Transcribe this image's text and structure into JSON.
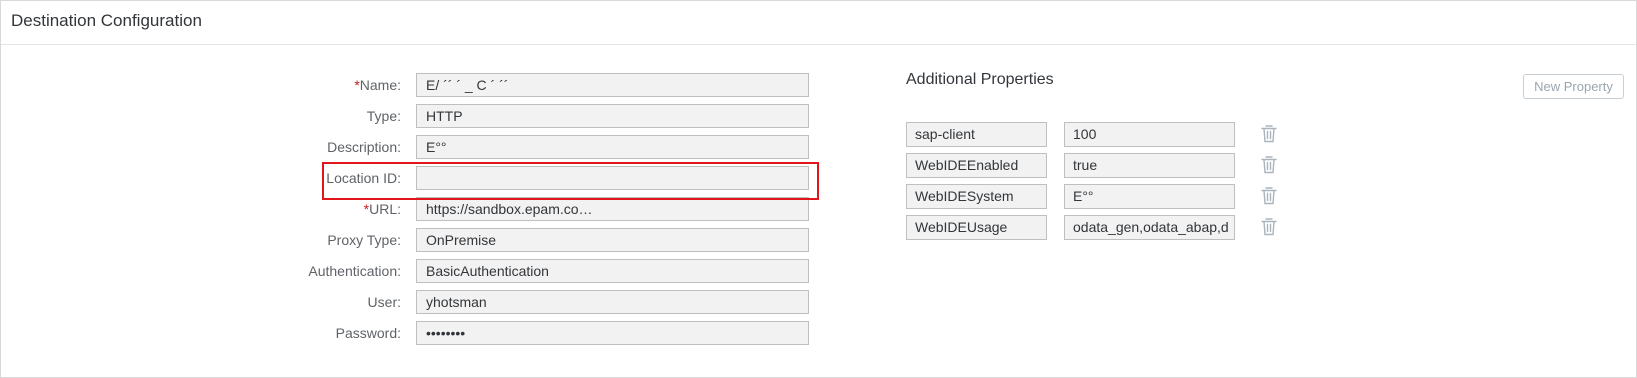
{
  "panel": {
    "title": "Destination Configuration"
  },
  "form": {
    "fields": [
      {
        "label": "Name:",
        "required": true,
        "value": "E/ ´´ ´ _ C ´ ´´"
      },
      {
        "label": "Type:",
        "required": false,
        "value": "HTTP"
      },
      {
        "label": "Description:",
        "required": false,
        "value": "E°°"
      },
      {
        "label": "Location ID:",
        "required": false,
        "value": ""
      },
      {
        "label": "URL:",
        "required": true,
        "value": "https://sandbox.epam.co…"
      },
      {
        "label": "Proxy Type:",
        "required": false,
        "value": "OnPremise"
      },
      {
        "label": "Authentication:",
        "required": false,
        "value": "BasicAuthentication"
      },
      {
        "label": "User:",
        "required": false,
        "value": "yhotsman"
      },
      {
        "label": "Password:",
        "required": false,
        "value": "••••••••"
      }
    ],
    "required_marker": "*"
  },
  "additional": {
    "title": "Additional Properties",
    "new_property_label": "New Property",
    "properties": [
      {
        "key": "sap-client",
        "value": "100",
        "icon": "trash-icon"
      },
      {
        "key": "WebIDEEnabled",
        "value": "true",
        "icon": "trash-icon"
      },
      {
        "key": "WebIDESystem",
        "value": "E°°",
        "icon": "trash-icon"
      },
      {
        "key": "WebIDEUsage",
        "value": "odata_gen,odata_abap,d",
        "icon": "trash-icon"
      }
    ]
  },
  "colors": {
    "required": "#cc1919",
    "highlight_border": "#e0161c",
    "icon": "#a9b4be"
  }
}
